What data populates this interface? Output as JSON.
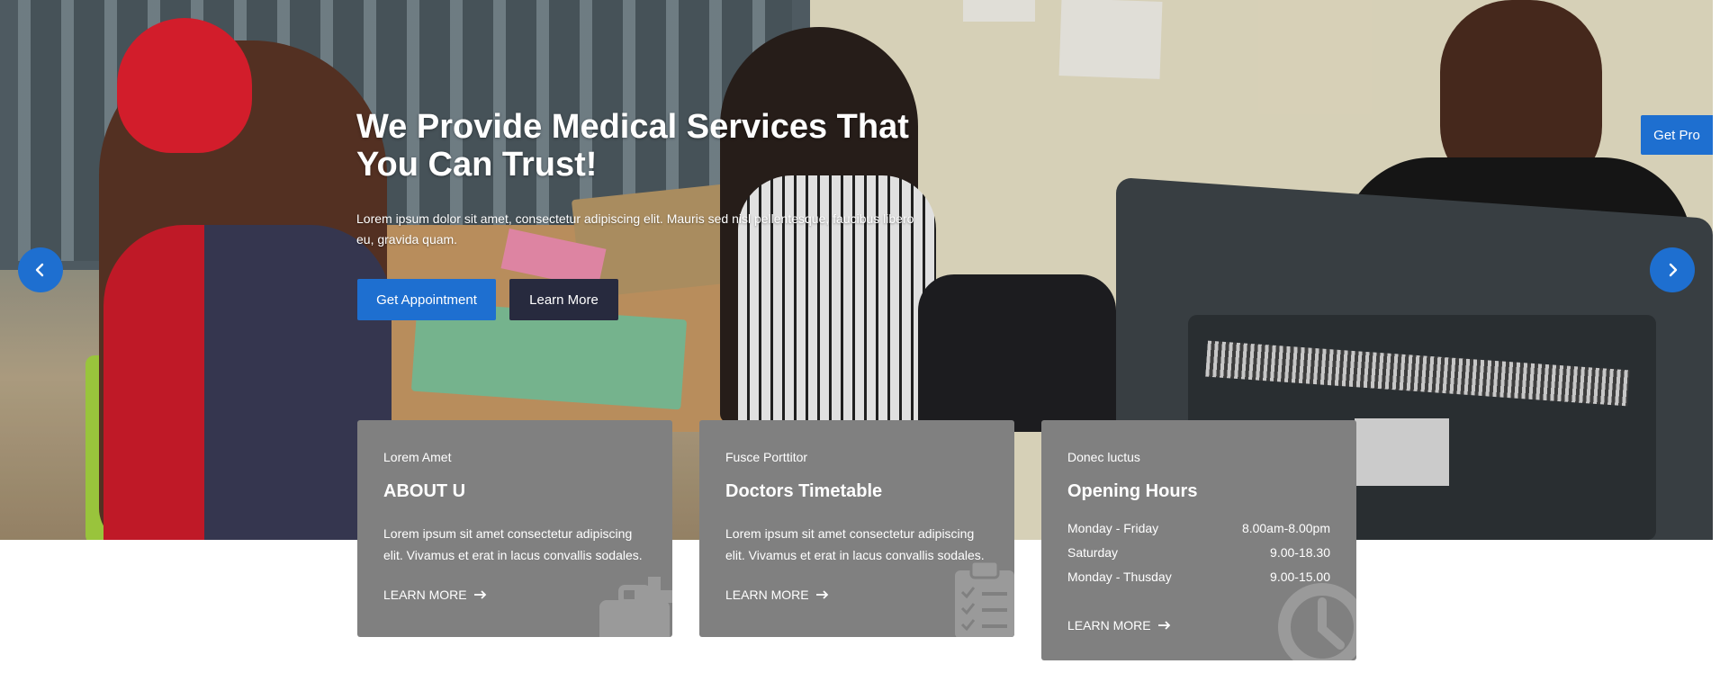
{
  "hero": {
    "title": "We Provide Medical Services That You Can Trust!",
    "text": "Lorem ipsum dolor sit amet, consectetur adipiscing elit. Mauris sed nisl pellentesque, faucibus libero eu, gravida quam.",
    "primary_button": "Get Appointment",
    "secondary_button": "Learn More"
  },
  "floating": {
    "get_pro": "Get Pro"
  },
  "slider": {
    "prev_icon": "chevron-left-icon",
    "next_icon": "chevron-right-icon"
  },
  "cards": [
    {
      "kicker": "Lorem Amet",
      "title": "ABOUT U",
      "text": "Lorem ipsum sit amet consectetur adipiscing elit. Vivamus et erat in lacus convallis sodales.",
      "link": "LEARN MORE",
      "icon": "medkit-icon"
    },
    {
      "kicker": "Fusce Porttitor",
      "title": "Doctors Timetable",
      "text": "Lorem ipsum sit amet consectetur adipiscing elit. Vivamus et erat in lacus convallis sodales.",
      "link": "LEARN MORE",
      "icon": "clipboard-icon"
    },
    {
      "kicker": "Donec luctus",
      "title": "Opening Hours",
      "hours": [
        {
          "day": "Monday - Friday",
          "time": "8.00am-8.00pm"
        },
        {
          "day": "Saturday",
          "time": "9.00-18.30"
        },
        {
          "day": "Monday - Thusday",
          "time": "9.00-15.00"
        }
      ],
      "link": "LEARN MORE",
      "icon": "clock-icon"
    }
  ],
  "colors": {
    "accent": "#1e6fd0",
    "dark_button": "#272a3e",
    "card_bg": "#808080"
  }
}
